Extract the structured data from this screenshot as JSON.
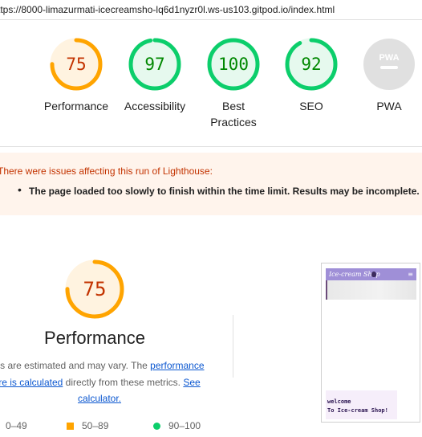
{
  "url": "ttps://8000-limazurmati-icecreamsho-lq6d1nyzr0l.ws-us103.gitpod.io/index.html",
  "colors": {
    "average": "#ffa400",
    "pass": "#0cce6b",
    "fail": "#ff4e42",
    "na": "#e0e0e0"
  },
  "gauges": [
    {
      "label": "Performance",
      "score": "75",
      "value": 75,
      "status": "average"
    },
    {
      "label": "Accessibility",
      "score": "97",
      "value": 97,
      "status": "pass"
    },
    {
      "label": "Best\nPractices",
      "score": "100",
      "value": 100,
      "status": "pass"
    },
    {
      "label": "SEO",
      "score": "92",
      "value": 92,
      "status": "pass"
    },
    {
      "label": "PWA",
      "score": "PWA",
      "status": "na"
    }
  ],
  "warning": {
    "title": "There were issues affecting this run of Lighthouse:",
    "items": [
      "The page loaded too slowly to finish within the time limit. Results may be incomplete."
    ]
  },
  "performance": {
    "score": "75",
    "value": 75,
    "title": "Performance",
    "desc_pre": "es are estimated and may vary. The ",
    "desc_link1": "performance",
    "desc_link2": "re is calculated",
    "desc_mid": " directly from these metrics. ",
    "desc_link3": "See",
    "desc_link4": "calculator."
  },
  "legend": [
    {
      "shape": "triangle",
      "label": "0–49"
    },
    {
      "shape": "square",
      "label": "50–89"
    },
    {
      "shape": "circle",
      "label": "90–100"
    }
  ],
  "screenshot": {
    "nav_title": "Ice-cream Shop",
    "menu_icon": "≡",
    "welcome_line1": "welcome",
    "welcome_line2": "To Ice-cream Shop!"
  }
}
